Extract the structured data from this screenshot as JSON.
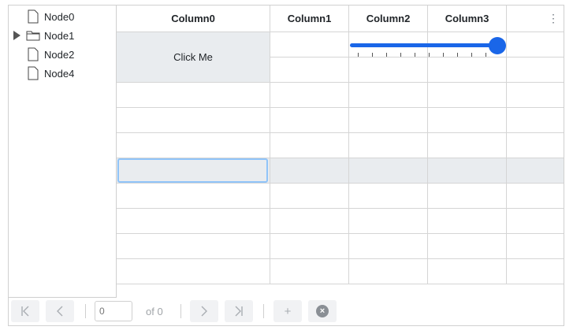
{
  "tree": {
    "nodes": [
      {
        "label": "Node0",
        "icon": "file-icon",
        "expandable": false
      },
      {
        "label": "Node1",
        "icon": "folder-icon",
        "expandable": true
      },
      {
        "label": "Node2",
        "icon": "file-icon",
        "expandable": false
      },
      {
        "label": "Node4",
        "icon": "file-icon",
        "expandable": false
      }
    ]
  },
  "grid": {
    "columns": [
      "Column0",
      "Column1",
      "Column2",
      "Column3"
    ],
    "menu_icon": "kebab-menu-icon",
    "button_label": "Click Me",
    "slider_value_fraction": 1.0,
    "accent_color": "#1a66e8"
  },
  "pager": {
    "page_value": "",
    "page_placeholder": "0",
    "total_label": "of 0",
    "first_label": "|<",
    "prev_label": "<",
    "next_label": ">",
    "last_label": ">|",
    "add_label": "+",
    "cancel_label": "×"
  }
}
